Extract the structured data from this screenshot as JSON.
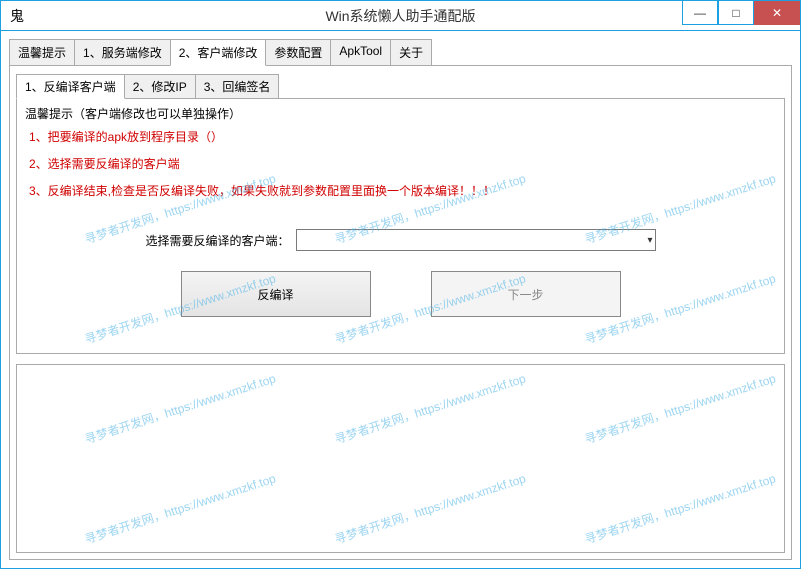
{
  "window": {
    "title": "Win系统懒人助手通配版",
    "icon_glyph": "鬼"
  },
  "controls": {
    "minimize": "—",
    "maximize": "□",
    "close": "✕"
  },
  "tabs": [
    {
      "label": "温馨提示"
    },
    {
      "label": "1、服务端修改"
    },
    {
      "label": "2、客户端修改"
    },
    {
      "label": "参数配置"
    },
    {
      "label": "ApkTool"
    },
    {
      "label": "关于"
    }
  ],
  "active_tab_index": 2,
  "inner_tabs": [
    {
      "label": "1、反编译客户端"
    },
    {
      "label": "2、修改IP"
    },
    {
      "label": "3、回编签名"
    }
  ],
  "active_inner_tab_index": 0,
  "hints": {
    "main": "温馨提示（客户端修改也可以单独操作）",
    "line1": "1、把要编译的apk放到程序目录（）",
    "line2": "2、选择需要反编译的客户端",
    "line3": "3、反编译结束,检查是否反编译失败，如果失败就到参数配置里面换一个版本编译！！！"
  },
  "select": {
    "label": "选择需要反编译的客户端：",
    "value": ""
  },
  "buttons": {
    "decompile": "反编译",
    "next": "下一步"
  },
  "watermark_text": "寻梦者开发网，https://www.xmzkf.top"
}
